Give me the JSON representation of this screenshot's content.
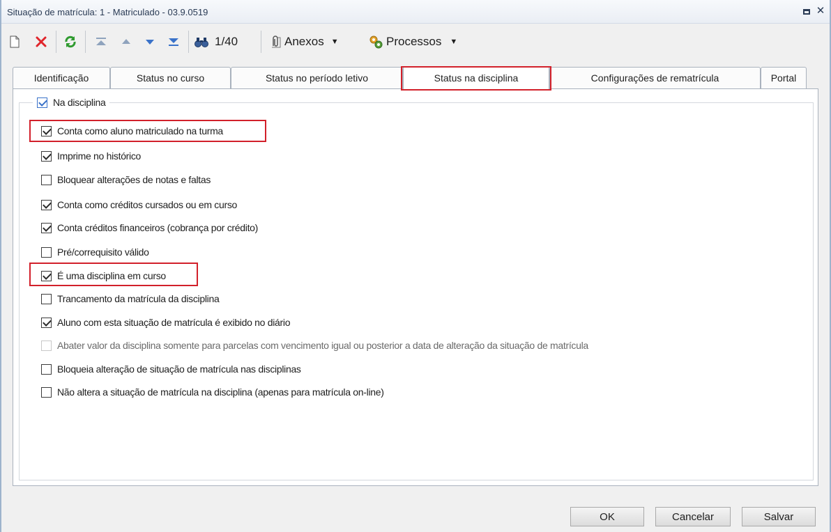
{
  "window": {
    "title": "Situação de matrícula: 1 - Matriculado - 03.9.0519"
  },
  "toolbar": {
    "record_position": "1/40",
    "attachments_label": "Anexos",
    "processes_label": "Processos"
  },
  "tabs": [
    {
      "label": "Identificação",
      "active": false
    },
    {
      "label": "Status no curso",
      "active": false
    },
    {
      "label": "Status no período letivo",
      "active": false
    },
    {
      "label": "Status na disciplina",
      "active": true
    },
    {
      "label": "Configurações de rematrícula",
      "active": false
    },
    {
      "label": "Portal",
      "active": false
    }
  ],
  "group": {
    "label": "Na disciplina",
    "checked": true
  },
  "options": [
    {
      "label": "Conta como aluno matriculado na turma",
      "checked": true,
      "enabled": true
    },
    {
      "label": "Imprime no histórico",
      "checked": true,
      "enabled": true
    },
    {
      "label": "Bloquear alterações de notas e faltas",
      "checked": false,
      "enabled": true
    },
    {
      "label": "Conta como créditos cursados ou em curso",
      "checked": true,
      "enabled": true
    },
    {
      "label": "Conta créditos financeiros (cobrança por crédito)",
      "checked": true,
      "enabled": true
    },
    {
      "label": "Pré/correquisito válido",
      "checked": false,
      "enabled": true
    },
    {
      "label": "É uma disciplina em curso",
      "checked": true,
      "enabled": true
    },
    {
      "label": "Trancamento da matrícula da disciplina",
      "checked": false,
      "enabled": true
    },
    {
      "label": "Aluno com esta situação de matrícula é exibido no diário",
      "checked": true,
      "enabled": true
    },
    {
      "label": "Abater valor da disciplina somente para parcelas com vencimento igual ou posterior a data de alteração da situação de matrícula",
      "checked": false,
      "enabled": false
    },
    {
      "label": "Bloqueia alteração de situação de matrícula nas disciplinas",
      "checked": false,
      "enabled": true
    },
    {
      "label": "Não altera a situação de matrícula na disciplina (apenas para matrícula on-line)",
      "checked": false,
      "enabled": true
    }
  ],
  "footer": {
    "ok_label": "OK",
    "cancel_label": "Cancelar",
    "save_label": "Salvar"
  },
  "colors": {
    "highlight": "#d2202a",
    "delete_icon": "#e0252b",
    "refresh_icon": "#2f9a2f",
    "nav_icon": "#3a72c9"
  }
}
